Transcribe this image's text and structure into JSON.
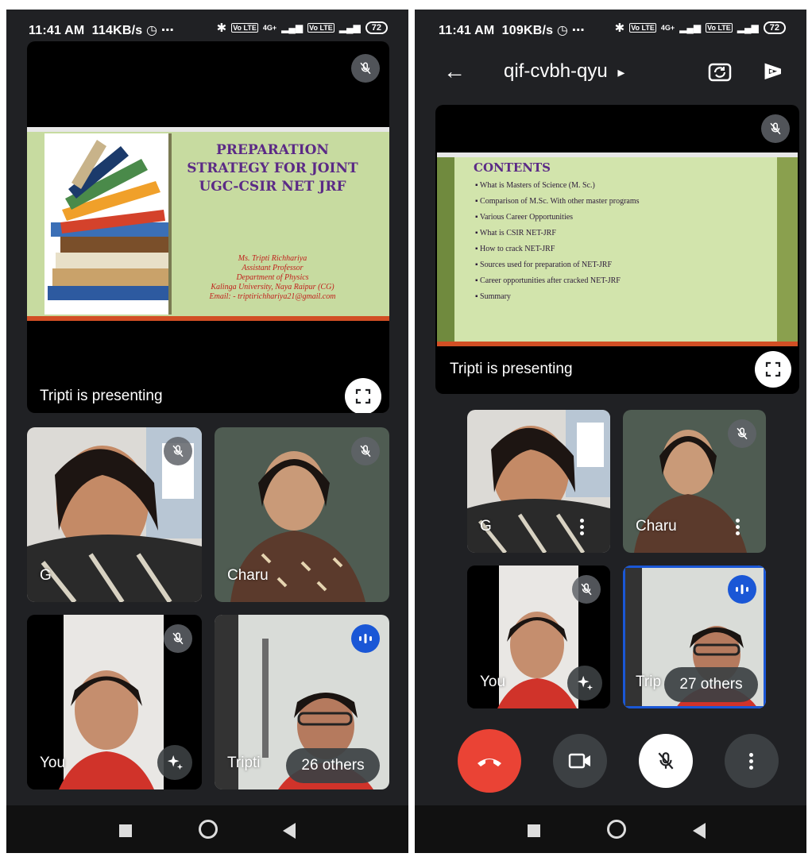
{
  "left": {
    "status": {
      "time": "11:41 AM",
      "speed": "114KB/s",
      "alarm_icon": "alarm-clock-icon",
      "more": "⋯",
      "volte1": "Vo LTE",
      "volte2": "Vo LTE",
      "net": "4G+",
      "battery": "72"
    },
    "presentation": {
      "slide_title": "PREPARATION STRATEGY FOR JOINT UGC-CSIR NET JRF",
      "author_lines": [
        "Ms. Tripti Richhariya",
        "Assistant Professor",
        "Department of Physics",
        "Kalinga University, Naya Raipur (CG)",
        "Email: - triptirichhariya21@gmail.com"
      ],
      "label": "Tripti is presenting"
    },
    "participants": [
      {
        "name": "G",
        "mic": "muted"
      },
      {
        "name": "Charu",
        "mic": "muted"
      },
      {
        "name": "You",
        "mic": "muted"
      },
      {
        "name": "Tripti",
        "mic": "speaking"
      }
    ],
    "others": "26 others"
  },
  "right": {
    "status": {
      "time": "11:41 AM",
      "speed": "109KB/s",
      "alarm_icon": "alarm-clock-icon",
      "more": "⋯",
      "volte1": "Vo LTE",
      "volte2": "Vo LTE",
      "net": "4G+",
      "battery": "72"
    },
    "header": {
      "meeting_code": "qif-cvbh-qyu",
      "caret": "▸"
    },
    "presentation": {
      "slide_heading": "CONTENTS",
      "bullets": [
        "What is Masters of Science (M. Sc.)",
        "Comparison of  M.Sc. With other master programs",
        "Various Career Opportunities",
        "What is CSIR NET-JRF",
        "How to crack NET-JRF",
        "Sources used for preparation of NET-JRF",
        "Career opportunities after cracked NET-JRF",
        "Summary"
      ],
      "label": "Tripti is presenting"
    },
    "participants": [
      {
        "name": "G",
        "mic": "muted"
      },
      {
        "name": "Charu",
        "mic": "muted"
      },
      {
        "name": "You",
        "mic": "muted"
      },
      {
        "name": "Trip",
        "mic": "speaking"
      }
    ],
    "others": "27 others"
  },
  "colors": {
    "app_bg": "#202124",
    "end_call": "#ea4335",
    "speaking": "#1a57d6",
    "slide_green": "#c7dba0",
    "slide_title_ink": "#5b2a86"
  }
}
